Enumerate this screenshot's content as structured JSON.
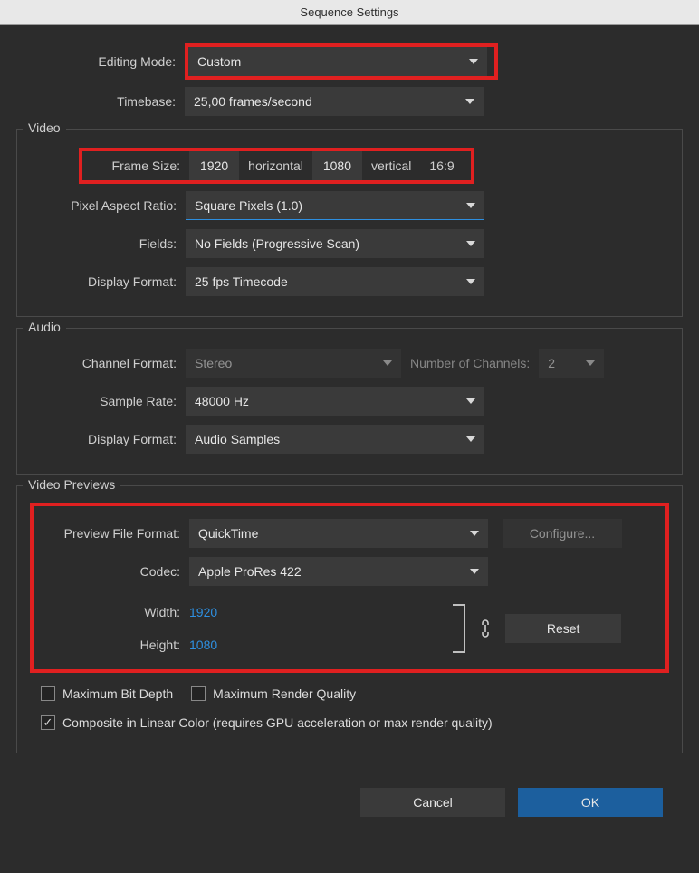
{
  "title": "Sequence Settings",
  "editing_mode": {
    "label": "Editing Mode:",
    "value": "Custom"
  },
  "timebase": {
    "label": "Timebase:",
    "value": "25,00  frames/second"
  },
  "video": {
    "legend": "Video",
    "frame_size": {
      "label": "Frame Size:",
      "w": "1920",
      "h_label": "horizontal",
      "h": "1080",
      "v_label": "vertical",
      "aspect": "16:9"
    },
    "par": {
      "label": "Pixel Aspect Ratio:",
      "value": "Square Pixels (1.0)"
    },
    "fields": {
      "label": "Fields:",
      "value": "No Fields (Progressive Scan)"
    },
    "display_format": {
      "label": "Display Format:",
      "value": "25 fps Timecode"
    }
  },
  "audio": {
    "legend": "Audio",
    "channel_format": {
      "label": "Channel Format:",
      "value": "Stereo"
    },
    "num_channels": {
      "label": "Number of Channels:",
      "value": "2"
    },
    "sample_rate": {
      "label": "Sample Rate:",
      "value": "48000 Hz"
    },
    "display_format": {
      "label": "Display Format:",
      "value": "Audio Samples"
    }
  },
  "previews": {
    "legend": "Video Previews",
    "file_format": {
      "label": "Preview File Format:",
      "value": "QuickTime"
    },
    "configure": "Configure...",
    "codec": {
      "label": "Codec:",
      "value": "Apple ProRes 422"
    },
    "width": {
      "label": "Width:",
      "value": "1920"
    },
    "height": {
      "label": "Height:",
      "value": "1080"
    },
    "reset": "Reset",
    "max_bit_depth": "Maximum Bit Depth",
    "max_render_quality": "Maximum Render Quality",
    "composite": "Composite in Linear Color (requires GPU acceleration or max render quality)"
  },
  "buttons": {
    "cancel": "Cancel",
    "ok": "OK"
  }
}
